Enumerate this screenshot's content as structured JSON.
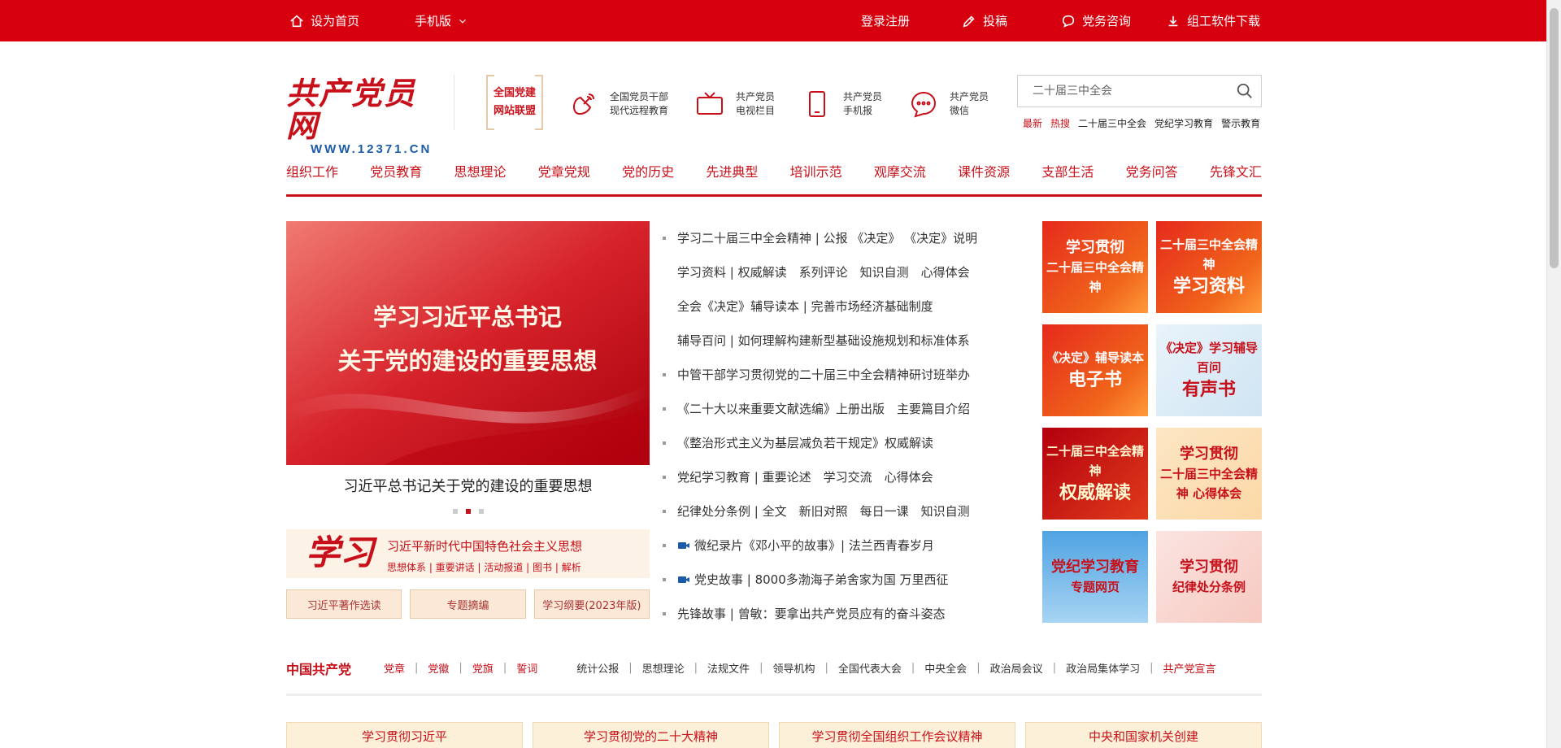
{
  "topbar": {
    "home": "设为首页",
    "mobile": "手机版",
    "login": "登录注册",
    "submit": "投稿",
    "consult": "党务咨询",
    "download": "组工软件下载"
  },
  "header": {
    "logo_text": "共产党员网",
    "logo_url": "WWW.12371.CN",
    "alliance_line1": "全国党建",
    "alliance_line2": "网站联盟",
    "links": [
      {
        "line1": "全国党员干部",
        "line2": "现代远程教育"
      },
      {
        "line1": "共产党员",
        "line2": "电视栏目"
      },
      {
        "line1": "共产党员",
        "line2": "手机报"
      },
      {
        "line1": "共产党员",
        "line2": "微信"
      }
    ],
    "search_placeholder": "二十届三中全会",
    "hot_labels": [
      "最新",
      "热搜"
    ],
    "hot_keywords": [
      "二十届三中全会",
      "党纪学习教育",
      "警示教育"
    ]
  },
  "nav": [
    "组织工作",
    "党员教育",
    "思想理论",
    "党章党规",
    "党的历史",
    "先进典型",
    "培训示范",
    "观摩交流",
    "课件资源",
    "支部生活",
    "党务问答",
    "先锋文汇"
  ],
  "carousel": {
    "slide_line1": "学习习近平总书记",
    "slide_line2": "关于党的建设的重要思想",
    "caption": "习近平总书记关于党的建设的重要思想",
    "active_dot": 2
  },
  "xuexi": {
    "brush": "学习",
    "title": "习近平新时代中国特色社会主义思想",
    "links": "思想体系 | 重要讲话 | 活动报道 | 图书 | 解析"
  },
  "sub_buttons": [
    "习近平著作选读",
    "专题摘编",
    "学习纲要(2023年版)"
  ],
  "news": [
    {
      "text": "学习二十届三中全会精神 | 公报 《决定》 《决定》说明",
      "dot": true,
      "cam": false
    },
    {
      "text": "学习资料 | 权威解读　系列评论　知识自测　心得体会",
      "dot": false,
      "cam": false
    },
    {
      "text": "全会《决定》辅导读本 | 完善市场经济基础制度",
      "dot": false,
      "cam": false
    },
    {
      "text": "辅导百问 | 如何理解构建新型基础设施规划和标准体系",
      "dot": false,
      "cam": false
    },
    {
      "text": "中管干部学习贯彻党的二十届三中全会精神研讨班举办",
      "dot": true,
      "cam": false
    },
    {
      "text": "《二十大以来重要文献选编》上册出版　主要篇目介绍",
      "dot": true,
      "cam": false
    },
    {
      "text": "《整治形式主义为基层减负若干规定》权威解读",
      "dot": true,
      "cam": false
    },
    {
      "text": "党纪学习教育 | 重要论述　学习交流　心得体会",
      "dot": true,
      "cam": false
    },
    {
      "text": "纪律处分条例 | 全文　新旧对照　每日一课　知识自测",
      "dot": true,
      "cam": false
    },
    {
      "text": "微纪录片《邓小平的故事》| 法兰西青春岁月",
      "dot": true,
      "cam": true
    },
    {
      "text": "党史故事 | 8000多渤海子弟舍家为国 万里西征",
      "dot": true,
      "cam": true
    },
    {
      "text": "先锋故事 | 曾敏：要拿出共产党员应有的奋斗姿态",
      "dot": true,
      "cam": false
    }
  ],
  "tiles": [
    {
      "l1": "学习贯彻",
      "l2": "二十届三中全会精神",
      "style": "t-red",
      "swap": true
    },
    {
      "l1": "二十届三中全会精神",
      "l2": "学习资料",
      "style": "t-red",
      "swap": false
    },
    {
      "l1": "《决定》辅导读本",
      "l2": "电子书",
      "style": "t-red",
      "swap": false
    },
    {
      "l1": "《决定》学习辅导百问",
      "l2": "有声书",
      "style": "t-light",
      "swap": false
    },
    {
      "l1": "二十届三中全会精神",
      "l2": "权威解读",
      "style": "t-dark",
      "swap": false
    },
    {
      "l1": "学习贯彻",
      "l2": "二十届三中全会精神 心得体会",
      "style": "t-cream",
      "swap": true
    },
    {
      "l1": "党纪学习教育",
      "l2": "专题网页",
      "style": "t-sky",
      "swap": true
    },
    {
      "l1": "学习贯彻",
      "l2": "纪律处分条例",
      "style": "t-pink",
      "swap": true
    }
  ],
  "party": {
    "title": "中国共产党",
    "red_links": [
      "党章",
      "党徽",
      "党旗",
      "誓词"
    ],
    "links": [
      "统计公报",
      "思想理论",
      "法规文件",
      "领导机构",
      "全国代表大会",
      "中央全会",
      "政治局会议",
      "政治局集体学习"
    ],
    "end_link": "共产党宣言"
  },
  "banners": [
    "学习贯彻习近平",
    "学习贯彻党的二十大精神",
    "学习贯彻全国组织工作会议精神",
    "中央和国家机关创建"
  ],
  "colors": {
    "brand_red": "#d7000f",
    "text_red": "#c8101a",
    "cream": "#fdf2e6"
  }
}
